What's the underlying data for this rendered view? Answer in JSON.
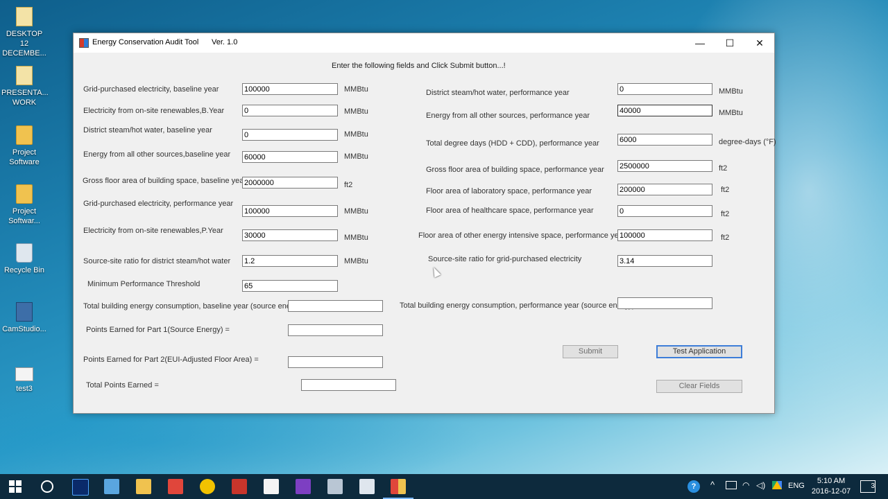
{
  "desktop": {
    "icons": [
      {
        "label": "DESKTOP 12 DECEMBE...",
        "icon": "file-icon"
      },
      {
        "label": "PRESENTA... WORK",
        "icon": "file-icon"
      },
      {
        "label": "Project Software",
        "icon": "folder-icon"
      },
      {
        "label": "Project Softwar...",
        "icon": "folder-icon"
      },
      {
        "label": "Recycle Bin",
        "icon": "recycle-bin-icon"
      },
      {
        "label": "CamStudio...",
        "icon": "camstudio-icon"
      },
      {
        "label": "test3",
        "icon": "text-file-icon"
      }
    ]
  },
  "window": {
    "title": "Energy Conservation Audit Tool",
    "version": "Ver. 1.0",
    "controls": {
      "minimize": "—",
      "maximize": "☐",
      "close": "✕"
    },
    "instruction": "Enter the following fields and Click Submit button...!"
  },
  "left_fields": [
    {
      "label": "Grid-purchased electricity, baseline year",
      "value": "100000",
      "unit": "MMBtu"
    },
    {
      "label": "Electricity from on-site renewables,B.Year",
      "value": "0",
      "unit": "MMBtu"
    },
    {
      "label": "District steam/hot water, baseline year",
      "value": "0",
      "unit": "MMBtu"
    },
    {
      "label": "Energy from all other sources,baseline year",
      "value": "60000",
      "unit": "MMBtu"
    },
    {
      "label": "Gross floor area of building space, baseline year",
      "value": "2000000",
      "unit": "ft2"
    },
    {
      "label": "Grid-purchased electricity, performance year",
      "value": "100000",
      "unit": "MMBtu"
    },
    {
      "label": "Electricity from on-site renewables,P.Year",
      "value": "30000",
      "unit": "MMBtu"
    },
    {
      "label": "Source-site ratio for district steam/hot water",
      "value": "1.2",
      "unit": "MMBtu"
    },
    {
      "label": "Minimum Performance Threshold",
      "value": "65",
      "unit": ""
    }
  ],
  "right_fields": [
    {
      "label": "District steam/hot water, performance year",
      "value": "0",
      "unit": "MMBtu"
    },
    {
      "label": "Energy from all other sources, performance year",
      "value": "40000",
      "unit": "MMBtu"
    },
    {
      "label": "Total degree days (HDD + CDD), performance year",
      "value": "6000",
      "unit": "degree-days (°F)"
    },
    {
      "label": "Gross floor area of building space, performance year",
      "value": "2500000",
      "unit": "ft2"
    },
    {
      "label": "Floor area of laboratory space, performance year",
      "value": "200000",
      "unit": "ft2"
    },
    {
      "label": "Floor area of healthcare space, performance year",
      "value": "0",
      "unit": "ft2"
    },
    {
      "label": "Floor area of other energy intensive space, performance year",
      "value": "100000",
      "unit": "ft2"
    },
    {
      "label": "Source-site ratio for grid-purchased electricity",
      "value": "3.14",
      "unit": ""
    }
  ],
  "results": {
    "total_baseline_label": "Total building energy consumption, baseline year (source energy)",
    "total_baseline_value": "",
    "total_performance_label": "Total building energy consumption, performance year (source energy)",
    "total_performance_value": "",
    "part1_label": "Points Earned for Part 1(Source Energy) =",
    "part1_value": "",
    "part2_label": "Points Earned for Part 2(EUI-Adjusted Floor Area)  =",
    "part2_value": "",
    "total_points_label": "Total Points Earned =",
    "total_points_value": ""
  },
  "buttons": {
    "submit": "Submit",
    "test_application": "Test Application",
    "clear_fields": "Clear Fields"
  },
  "taskbar": {
    "apps": [
      "photoshop-icon",
      "network-icon",
      "file-explorer-icon",
      "acrobat-icon",
      "chrome-icon",
      "pdf-editor-icon",
      "notepad-icon",
      "visual-studio-icon",
      "printer-icon",
      "window-icon",
      "app-icon"
    ],
    "tray": {
      "help": "?",
      "language": "ENG",
      "time": "5:10 AM",
      "date": "2016-12-07",
      "notifications": "3"
    }
  }
}
